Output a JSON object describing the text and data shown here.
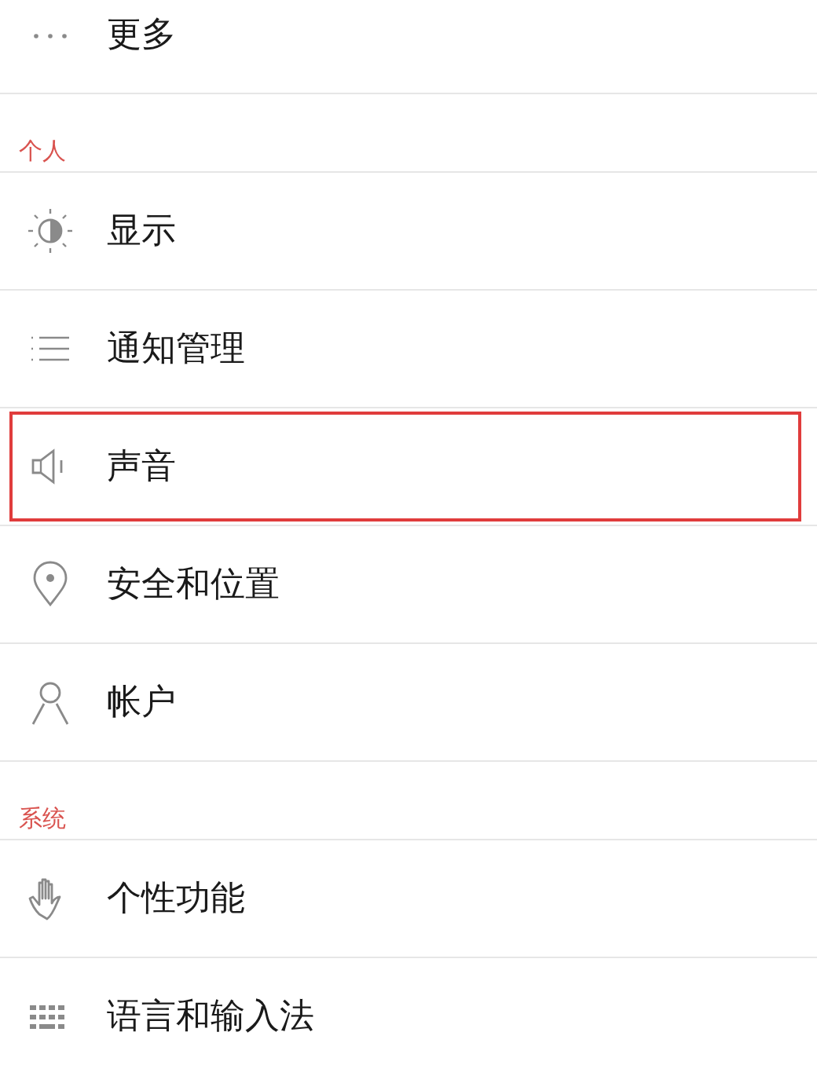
{
  "sections": [
    {
      "items": [
        {
          "label": "更多",
          "highlighted": false
        }
      ]
    },
    {
      "title": "个人",
      "items": [
        {
          "label": "显示",
          "highlighted": false
        },
        {
          "label": "通知管理",
          "highlighted": false
        },
        {
          "label": "声音",
          "highlighted": true
        },
        {
          "label": "安全和位置",
          "highlighted": false
        },
        {
          "label": "帐户",
          "highlighted": false
        }
      ]
    },
    {
      "title": "系统",
      "items": [
        {
          "label": "个性功能",
          "highlighted": false
        },
        {
          "label": "语言和输入法",
          "highlighted": false
        }
      ]
    }
  ]
}
